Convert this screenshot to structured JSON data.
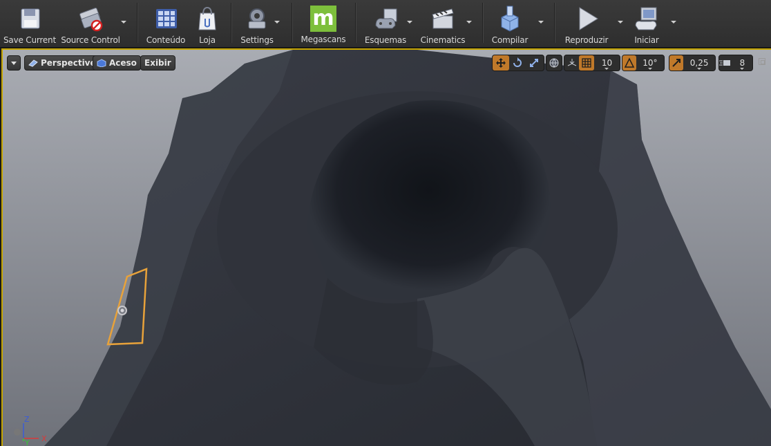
{
  "toolbar": {
    "buttons": [
      {
        "label": "Save Current",
        "icon": "save-icon"
      },
      {
        "label": "Source Control",
        "icon": "source-control-icon"
      },
      {
        "label": "Conteúdo",
        "icon": "content-icon"
      },
      {
        "label": "Loja",
        "icon": "store-icon"
      },
      {
        "label": "Settings",
        "icon": "settings-icon"
      },
      {
        "label": "Megascans",
        "icon": "megascans-icon"
      },
      {
        "label": "Esquemas",
        "icon": "blueprints-icon"
      },
      {
        "label": "Cinematics",
        "icon": "cinematics-icon"
      },
      {
        "label": "Compilar",
        "icon": "build-icon"
      },
      {
        "label": "Reproduzir",
        "icon": "play-icon"
      },
      {
        "label": "Iniciar",
        "icon": "launch-icon"
      }
    ],
    "megascans_letter": "m"
  },
  "viewport": {
    "view_mode": "Perspective",
    "lighting_mode": "Aceso",
    "show_label": "Exibir",
    "grid_snap_value": "10",
    "rotation_snap_value": "10°",
    "scale_snap_value": "0,25",
    "camera_speed_value": "8",
    "axis_labels": {
      "z": "Z",
      "x": "X",
      "y": "Y"
    }
  },
  "colors": {
    "accent": "#c0792a",
    "selection": "#e8a23a",
    "mesh": "#34373f",
    "background": "#8a8d94"
  }
}
